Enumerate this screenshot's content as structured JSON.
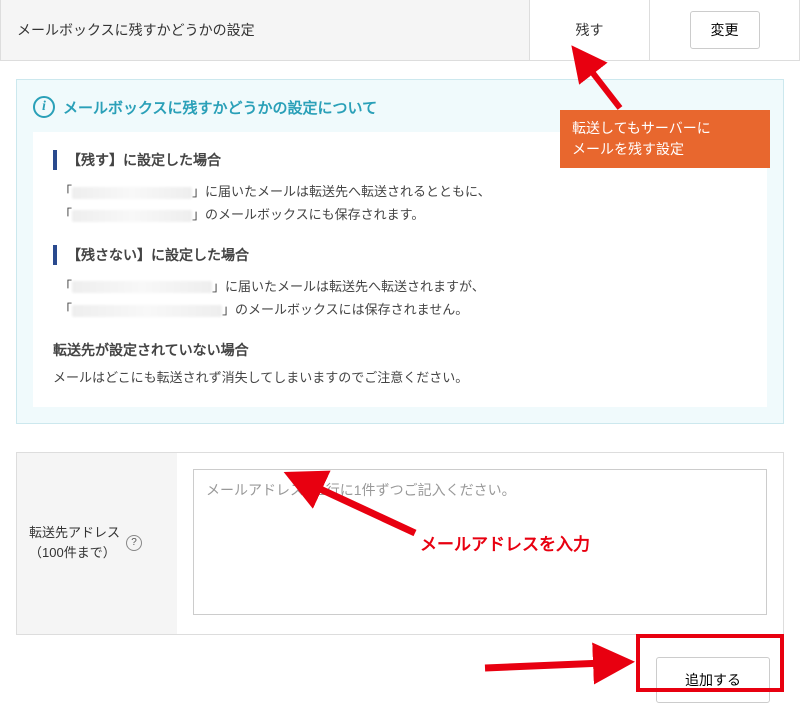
{
  "setting": {
    "label": "メールボックスに残すかどうかの設定",
    "value": "残す",
    "change_button": "変更"
  },
  "info": {
    "title": "メールボックスに残すかどうかの設定について",
    "case1_title": "【残す】に設定した場合",
    "case1_line1_suffix": "」に届いたメールは転送先へ転送されるとともに、",
    "case1_line2_suffix": "」のメールボックスにも保存されます。",
    "case2_title": "【残さない】に設定した場合",
    "case2_line1_suffix": "」に届いたメールは転送先へ転送されますが、",
    "case2_line2_suffix": "」のメールボックスには保存されません。",
    "case3_title": "転送先が設定されていない場合",
    "case3_text": "メールはどこにも転送されず消失してしまいますのでご注意ください。"
  },
  "form": {
    "label_line1": "転送先アドレス",
    "label_line2": "（100件まで）",
    "placeholder": "メールアドレスを1行に1件ずつご記入ください。"
  },
  "footer": {
    "add_button": "追加する"
  },
  "annotations": {
    "orange1_line1": "転送してもサーバーに",
    "orange1_line2": "メールを残す設定",
    "red_text": "メールアドレスを入力"
  }
}
